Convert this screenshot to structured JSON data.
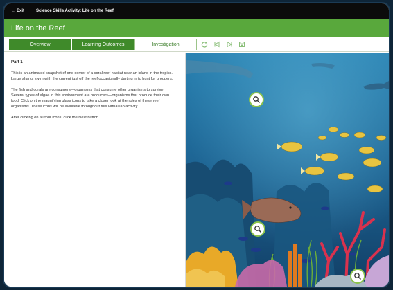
{
  "topbar": {
    "exit_label": "Exit",
    "activity_title": "Science Skills Activity: Life on the Reef"
  },
  "header": {
    "title": "Life on the Reef"
  },
  "tabs": [
    {
      "label": "Overview"
    },
    {
      "label": "Learning Outcomes"
    },
    {
      "label": "Investigation"
    }
  ],
  "controls": {
    "icons": [
      "reset-icon",
      "back-icon",
      "forward-icon",
      "save-icon"
    ]
  },
  "content": {
    "heading": "Part 1",
    "paragraphs": [
      "This is an animated snapshot of one corner of a coral reef habitat near an island in the tropics. Large sharks swim with the current just off the reef occasionally darting in to hunt for groupers.",
      "The fish and corals are consumers—organisms that consume other organisms to survive. Several types of algae in this environment are producers—organisms that produce their own food. Click on the magnifying glass icons to take a closer look at the roles of these reef organisms. These icons will be available throughout this virtual lab activity.",
      "After clicking on all four icons, click the Next button."
    ]
  },
  "colors": {
    "green": "#59a83c",
    "tab_green": "#3f8a2a",
    "ocean": "#1f6d9a"
  }
}
